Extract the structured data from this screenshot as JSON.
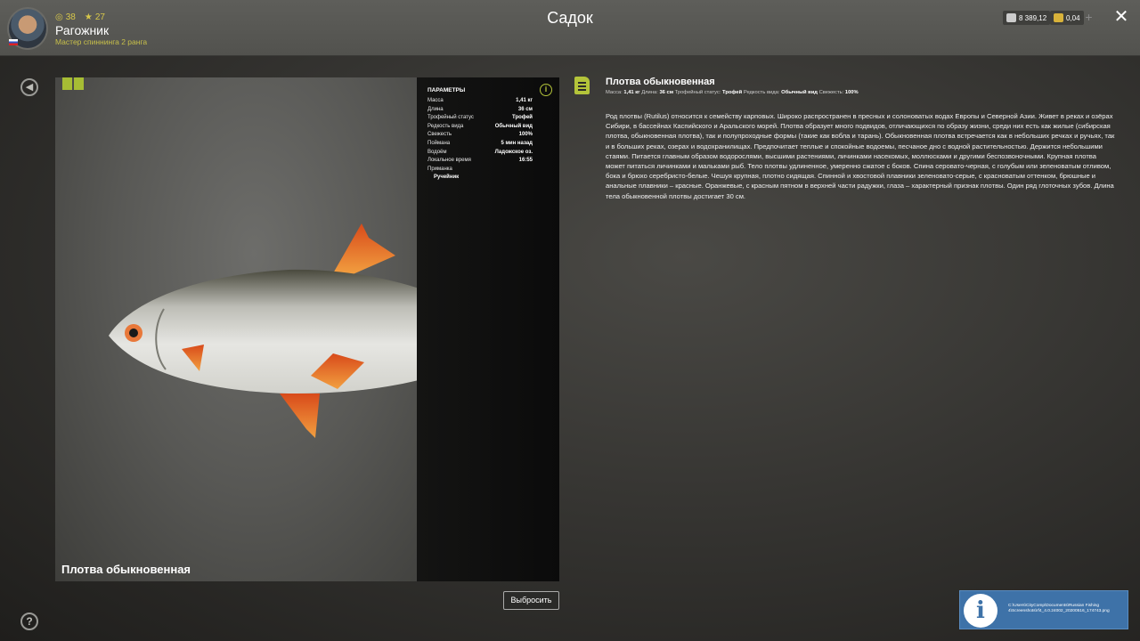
{
  "header": {
    "title": "Садок",
    "player": {
      "name": "Рагожник",
      "rank": "Мастер спиннинга 2 ранга",
      "level": "38",
      "stars": "27"
    },
    "currency": {
      "silver": "8 389,12",
      "gold": "0,04"
    }
  },
  "fish": {
    "caption": "Плотва обыкновенная",
    "params_title": "ПАРАМЕТРЫ",
    "params": [
      {
        "label": "Масса",
        "value": "1,41 кг"
      },
      {
        "label": "Длина",
        "value": "36 см"
      },
      {
        "label": "Трофейный статус",
        "value": "Трофей"
      },
      {
        "label": "Редкость вида",
        "value": "Обычный вид"
      },
      {
        "label": "Свежесть",
        "value": "100%"
      },
      {
        "label": "Поймана",
        "value": "5 мин назад"
      },
      {
        "label": "Водоём",
        "value": "Ладожское оз."
      },
      {
        "label": "Локальное время",
        "value": "16:55"
      },
      {
        "label": "Приманка",
        "value": ""
      }
    ],
    "bait": "Ручейник",
    "throw_label": "Выбросить"
  },
  "description": {
    "title": "Плотва обыкновенная",
    "meta": {
      "mass_label": "Масса:",
      "mass": "1,41 кг",
      "length_label": "Длина:",
      "length": "36 см",
      "trophy_label": "Трофейный статус:",
      "trophy": "Трофей",
      "rarity_label": "Редкость вида:",
      "rarity": "Обычный вид",
      "fresh_label": "Свежесть:",
      "fresh": "100%"
    },
    "text": "Род плотвы (Rutilus) относится к семейству карповых. Широко распространен в пресных и солоноватых водах Европы и Северной Азии. Живет в реках и озёрах Сибири, в бассейнах Каспийского и Аральского морей. Плотва образует много подвидов, отличающихся по образу жизни, среди них есть как жилые (сибирская плотва, обыкновенная плотва), так и полупроходные формы (такие как вобла и тарань). Обыкновенная плотва встречается как в небольших речках и ручьях, так и в больших реках, озерах и водохранилищах. Предпочитает теплые и спокойные водоемы, песчаное дно с водной растительностью. Держится небольшими стаями. Питается главным образом водорослями, высшими растениями, личинками насекомых, моллюсками и другими беспозвоночными. Крупная плотва может питаться личинками и мальками рыб. Тело плотвы удлиненное, умеренно сжатое с боков. Спина серовато-черная, с голубым или зеленоватым отливом, бока и брюхо серебристо-белые. Чешуя крупная, плотно сидящая. Спинной и хвостовой плавники зеленовато-серые, с красноватым оттенком, брюшные и анальные плавники – красные. Оранжевые, с красным пятном в верхней части радужки, глаза – характерный признак плотвы. Один ряд глоточных зубов. Длина тела обыкновенной плотвы достигает 30 см."
  },
  "toast": {
    "text": "C:\\Users\\CityComp\\Documents\\Russian Fishing 4\\Screenshots\\rf4_4.0.24002_20200516_174743.png"
  },
  "colors": {
    "accent": "#b4c43a",
    "panel_dark": "#0d0d0d",
    "toast_bg": "#3e72a8"
  }
}
